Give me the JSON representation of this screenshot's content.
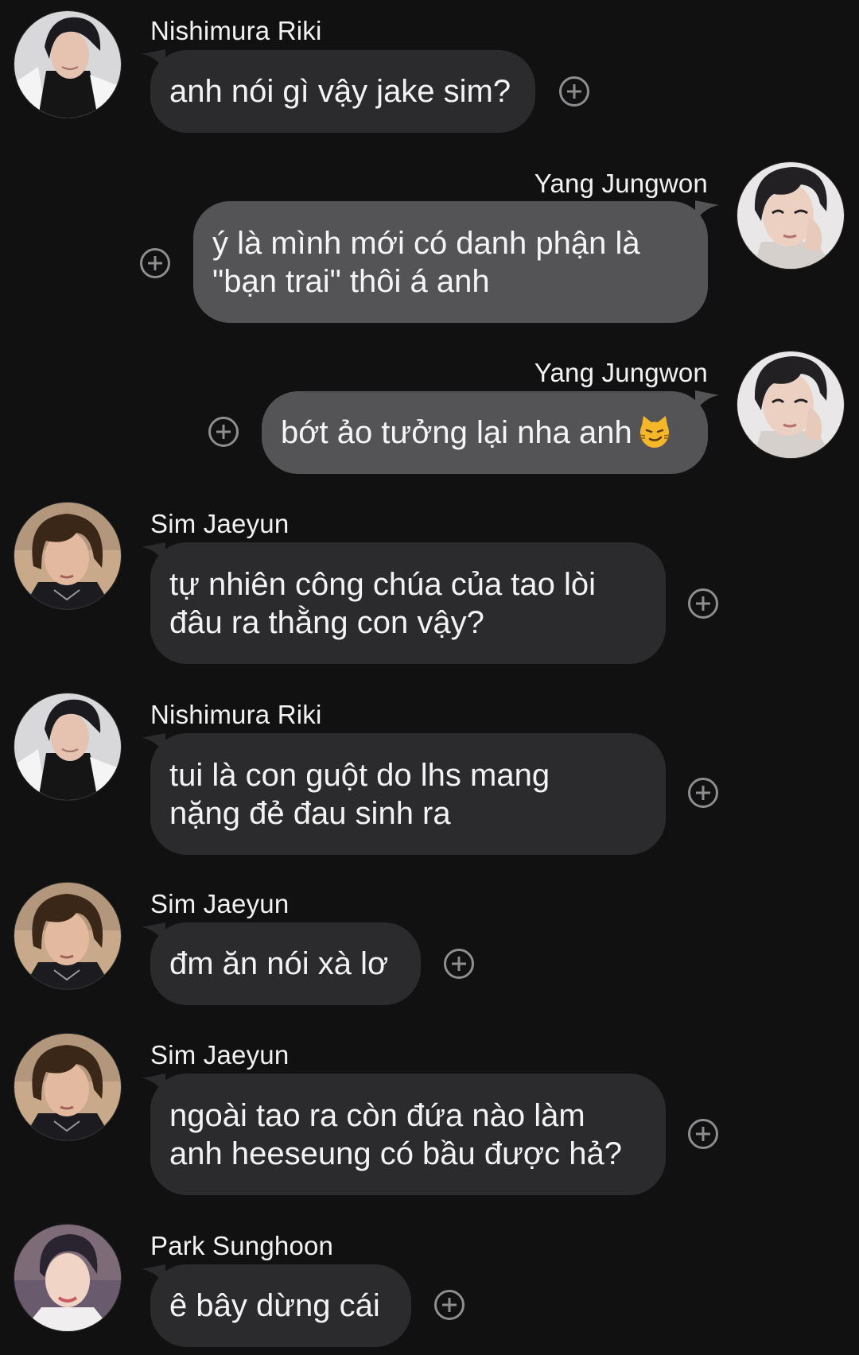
{
  "colors": {
    "background": "#111112",
    "incoming_bubble": "#2b2b2d",
    "outgoing_bubble": "#545456",
    "react_icon": "#8e8e90"
  },
  "messages": [
    {
      "sender": "Nishimura Riki",
      "side": "incoming",
      "lines": [
        "anh nói gì vậy jake sim?"
      ]
    },
    {
      "sender": "Yang Jungwon",
      "side": "outgoing",
      "lines": [
        "ý là mình mới có danh phận là",
        "\"bạn trai\" thôi á anh"
      ]
    },
    {
      "sender": "Yang Jungwon",
      "side": "outgoing",
      "lines": [
        "bớt ảo tưởng lại nha anh"
      ],
      "emoji": "smirking-cat-emoji"
    },
    {
      "sender": "Sim Jaeyun",
      "side": "incoming",
      "lines": [
        "tự nhiên công chúa của tao lòi",
        "đâu ra thằng con vậy?"
      ]
    },
    {
      "sender": "Nishimura Riki",
      "side": "incoming",
      "lines": [
        "tui là con guột do lhs mang",
        "nặng đẻ đau sinh ra"
      ]
    },
    {
      "sender": "Sim Jaeyun",
      "side": "incoming",
      "lines": [
        "đm ăn nói xà lơ"
      ]
    },
    {
      "sender": "Sim Jaeyun",
      "side": "incoming",
      "lines": [
        "ngoài tao ra còn đứa nào làm",
        "anh heeseung có bầu được hả?"
      ]
    },
    {
      "sender": "Park Sunghoon",
      "side": "incoming",
      "lines": [
        "ê bây dừng cái"
      ]
    }
  ],
  "icons": {
    "react": "add-reaction-icon",
    "avatar": "avatar-photo"
  }
}
